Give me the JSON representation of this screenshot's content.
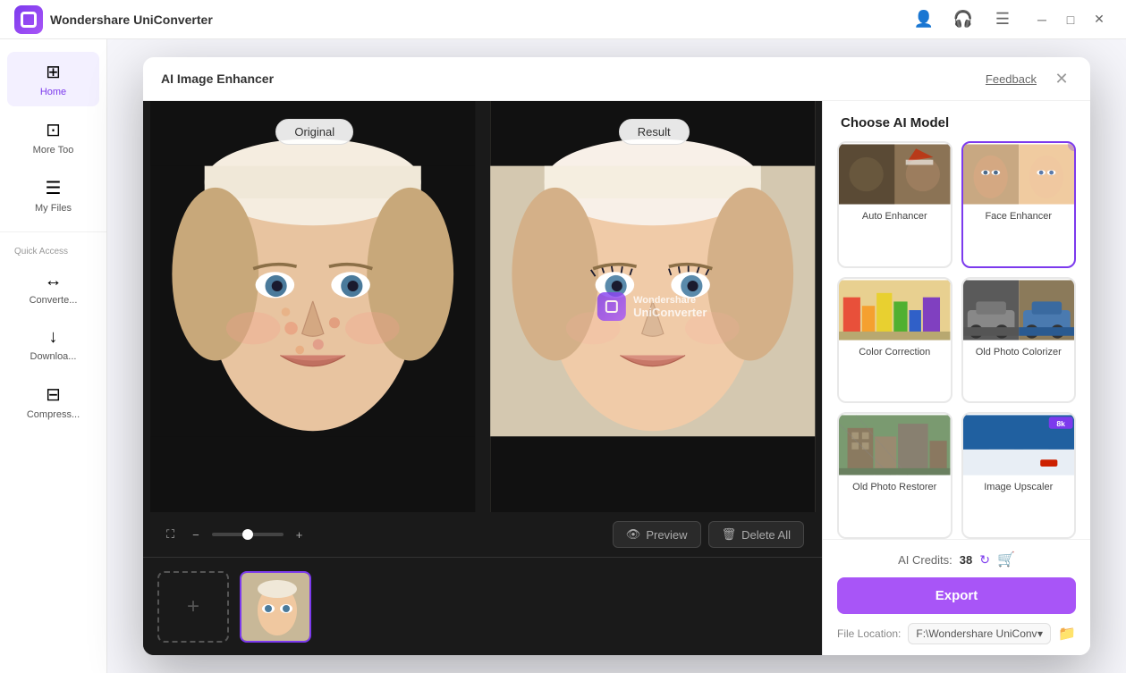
{
  "titleBar": {
    "appName": "Wondershare UniConverter",
    "feedbackLabel": "Feedback"
  },
  "sidebar": {
    "items": [
      {
        "id": "home",
        "label": "Home",
        "icon": "⊞",
        "active": true
      },
      {
        "id": "more-tools",
        "label": "More Too",
        "icon": "⊡",
        "active": false
      },
      {
        "id": "my-files",
        "label": "My Files",
        "icon": "☰",
        "active": false
      }
    ],
    "sections": [
      {
        "label": "Quick Access"
      }
    ],
    "quickItems": [
      {
        "id": "converter",
        "label": "Converte...",
        "icon": "↔"
      },
      {
        "id": "download",
        "label": "Downloa...",
        "icon": "↓"
      },
      {
        "id": "compress",
        "label": "Compress...",
        "icon": "⊟"
      }
    ]
  },
  "modal": {
    "title": "AI Image Enhancer",
    "feedbackLabel": "Feedback",
    "closeIcon": "✕"
  },
  "compareView": {
    "originalLabel": "Original",
    "resultLabel": "Result"
  },
  "toolbar": {
    "fitIcon": "⛶",
    "zoomOutIcon": "−",
    "zoomInIcon": "+",
    "zoomValue": "0",
    "previewIcon": "👁",
    "previewLabel": "Preview",
    "deleteIcon": "🗑",
    "deleteAllLabel": "Delete All"
  },
  "rightPanel": {
    "title": "Choose AI Model",
    "models": [
      {
        "id": "auto-enhancer",
        "label": "Auto Enhancer",
        "active": false,
        "theme": "auto"
      },
      {
        "id": "face-enhancer",
        "label": "Face Enhancer",
        "active": true,
        "theme": "face"
      },
      {
        "id": "color-correction",
        "label": "Color Correction",
        "active": false,
        "theme": "color"
      },
      {
        "id": "old-photo-colorizer",
        "label": "Old Photo Colorizer",
        "active": false,
        "theme": "colorize"
      },
      {
        "id": "old-photo-restorer",
        "label": "Old Photo Restorer",
        "active": false,
        "theme": "restore"
      },
      {
        "id": "image-upscaler",
        "label": "Image Upscaler",
        "active": false,
        "theme": "upscale",
        "badge": "8k"
      }
    ]
  },
  "footer": {
    "creditsLabel": "AI Credits:",
    "creditsCount": "38",
    "exportLabel": "Export",
    "fileLocationLabel": "File Location:",
    "fileLocationValue": "F:\\Wondershare UniConv",
    "folderIcon": "📁"
  },
  "addThumbnailIcon": "+"
}
